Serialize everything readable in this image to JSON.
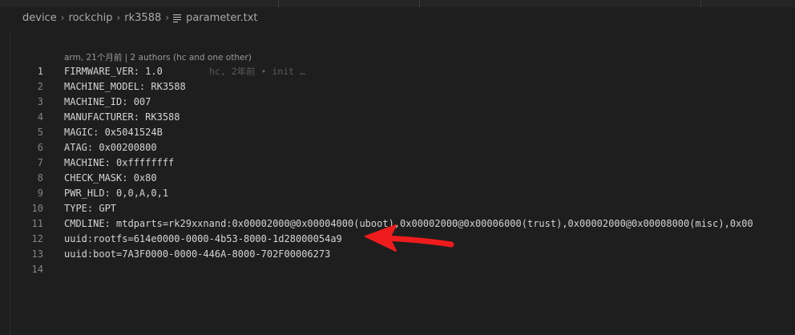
{
  "breadcrumb": {
    "items": [
      "device",
      "rockchip",
      "rk3588"
    ],
    "separator": "›",
    "file": "parameter.txt",
    "file_icon": "text-file-icon"
  },
  "codelens": "arm, 21个月前 | 2 authors (hc and one other)",
  "blame": "hc, 2年前 • init …",
  "lines": [
    {
      "n": "1",
      "text": "FIRMWARE_VER: 1.0"
    },
    {
      "n": "2",
      "text": "MACHINE_MODEL: RK3588"
    },
    {
      "n": "3",
      "text": "MACHINE_ID: 007"
    },
    {
      "n": "4",
      "text": "MANUFACTURER: RK3588"
    },
    {
      "n": "5",
      "text": "MAGIC: 0x5041524B"
    },
    {
      "n": "6",
      "text": "ATAG: 0x00200800"
    },
    {
      "n": "7",
      "text": "MACHINE: 0xffffffff"
    },
    {
      "n": "8",
      "text": "CHECK_MASK: 0x80"
    },
    {
      "n": "9",
      "text": "PWR_HLD: 0,0,A,0,1"
    },
    {
      "n": "10",
      "text": "TYPE: GPT"
    },
    {
      "n": "11",
      "text": "CMDLINE: mtdparts=rk29xxnand:0x00002000@0x00004000(uboot),0x00002000@0x00006000(trust),0x00002000@0x00008000(misc),0x00"
    },
    {
      "n": "12",
      "text": "uuid:rootfs=614e0000-0000-4b53-8000-1d28000054a9"
    },
    {
      "n": "13",
      "text": "uuid:boot=7A3F0000-0000-446A-8000-702F00006273"
    },
    {
      "n": "14",
      "text": ""
    }
  ],
  "annotation": {
    "icon": "red-arrow-icon",
    "color": "#ee1c1c"
  }
}
